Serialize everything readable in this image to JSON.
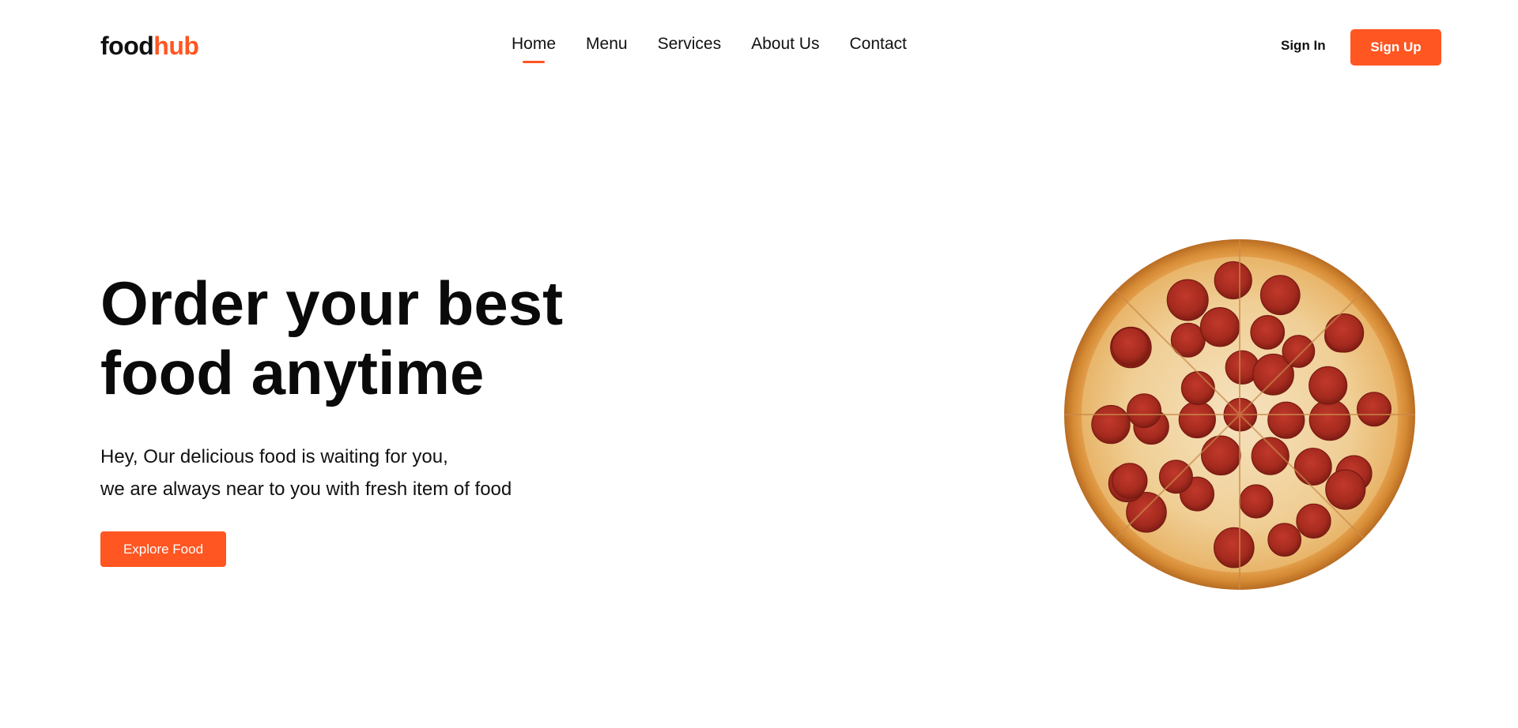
{
  "header": {
    "logo": {
      "part1": "food",
      "part2": "hub"
    },
    "nav": [
      {
        "label": "Home",
        "active": true
      },
      {
        "label": "Menu",
        "active": false
      },
      {
        "label": "Services",
        "active": false
      },
      {
        "label": "About Us",
        "active": false
      },
      {
        "label": "Contact",
        "active": false
      }
    ],
    "sign_in_label": "Sign In",
    "sign_up_label": "Sign Up"
  },
  "hero": {
    "title_line1": "Order your best",
    "title_line2": "food anytime",
    "text_line1": "Hey, Our delicious food is waiting for you,",
    "text_line2": "we are always near to you with fresh item of food",
    "cta_label": "Explore Food",
    "image_icon": "pepperoni-pizza-image"
  },
  "colors": {
    "accent": "#ff5622",
    "text": "#111111",
    "background": "#ffffff"
  }
}
